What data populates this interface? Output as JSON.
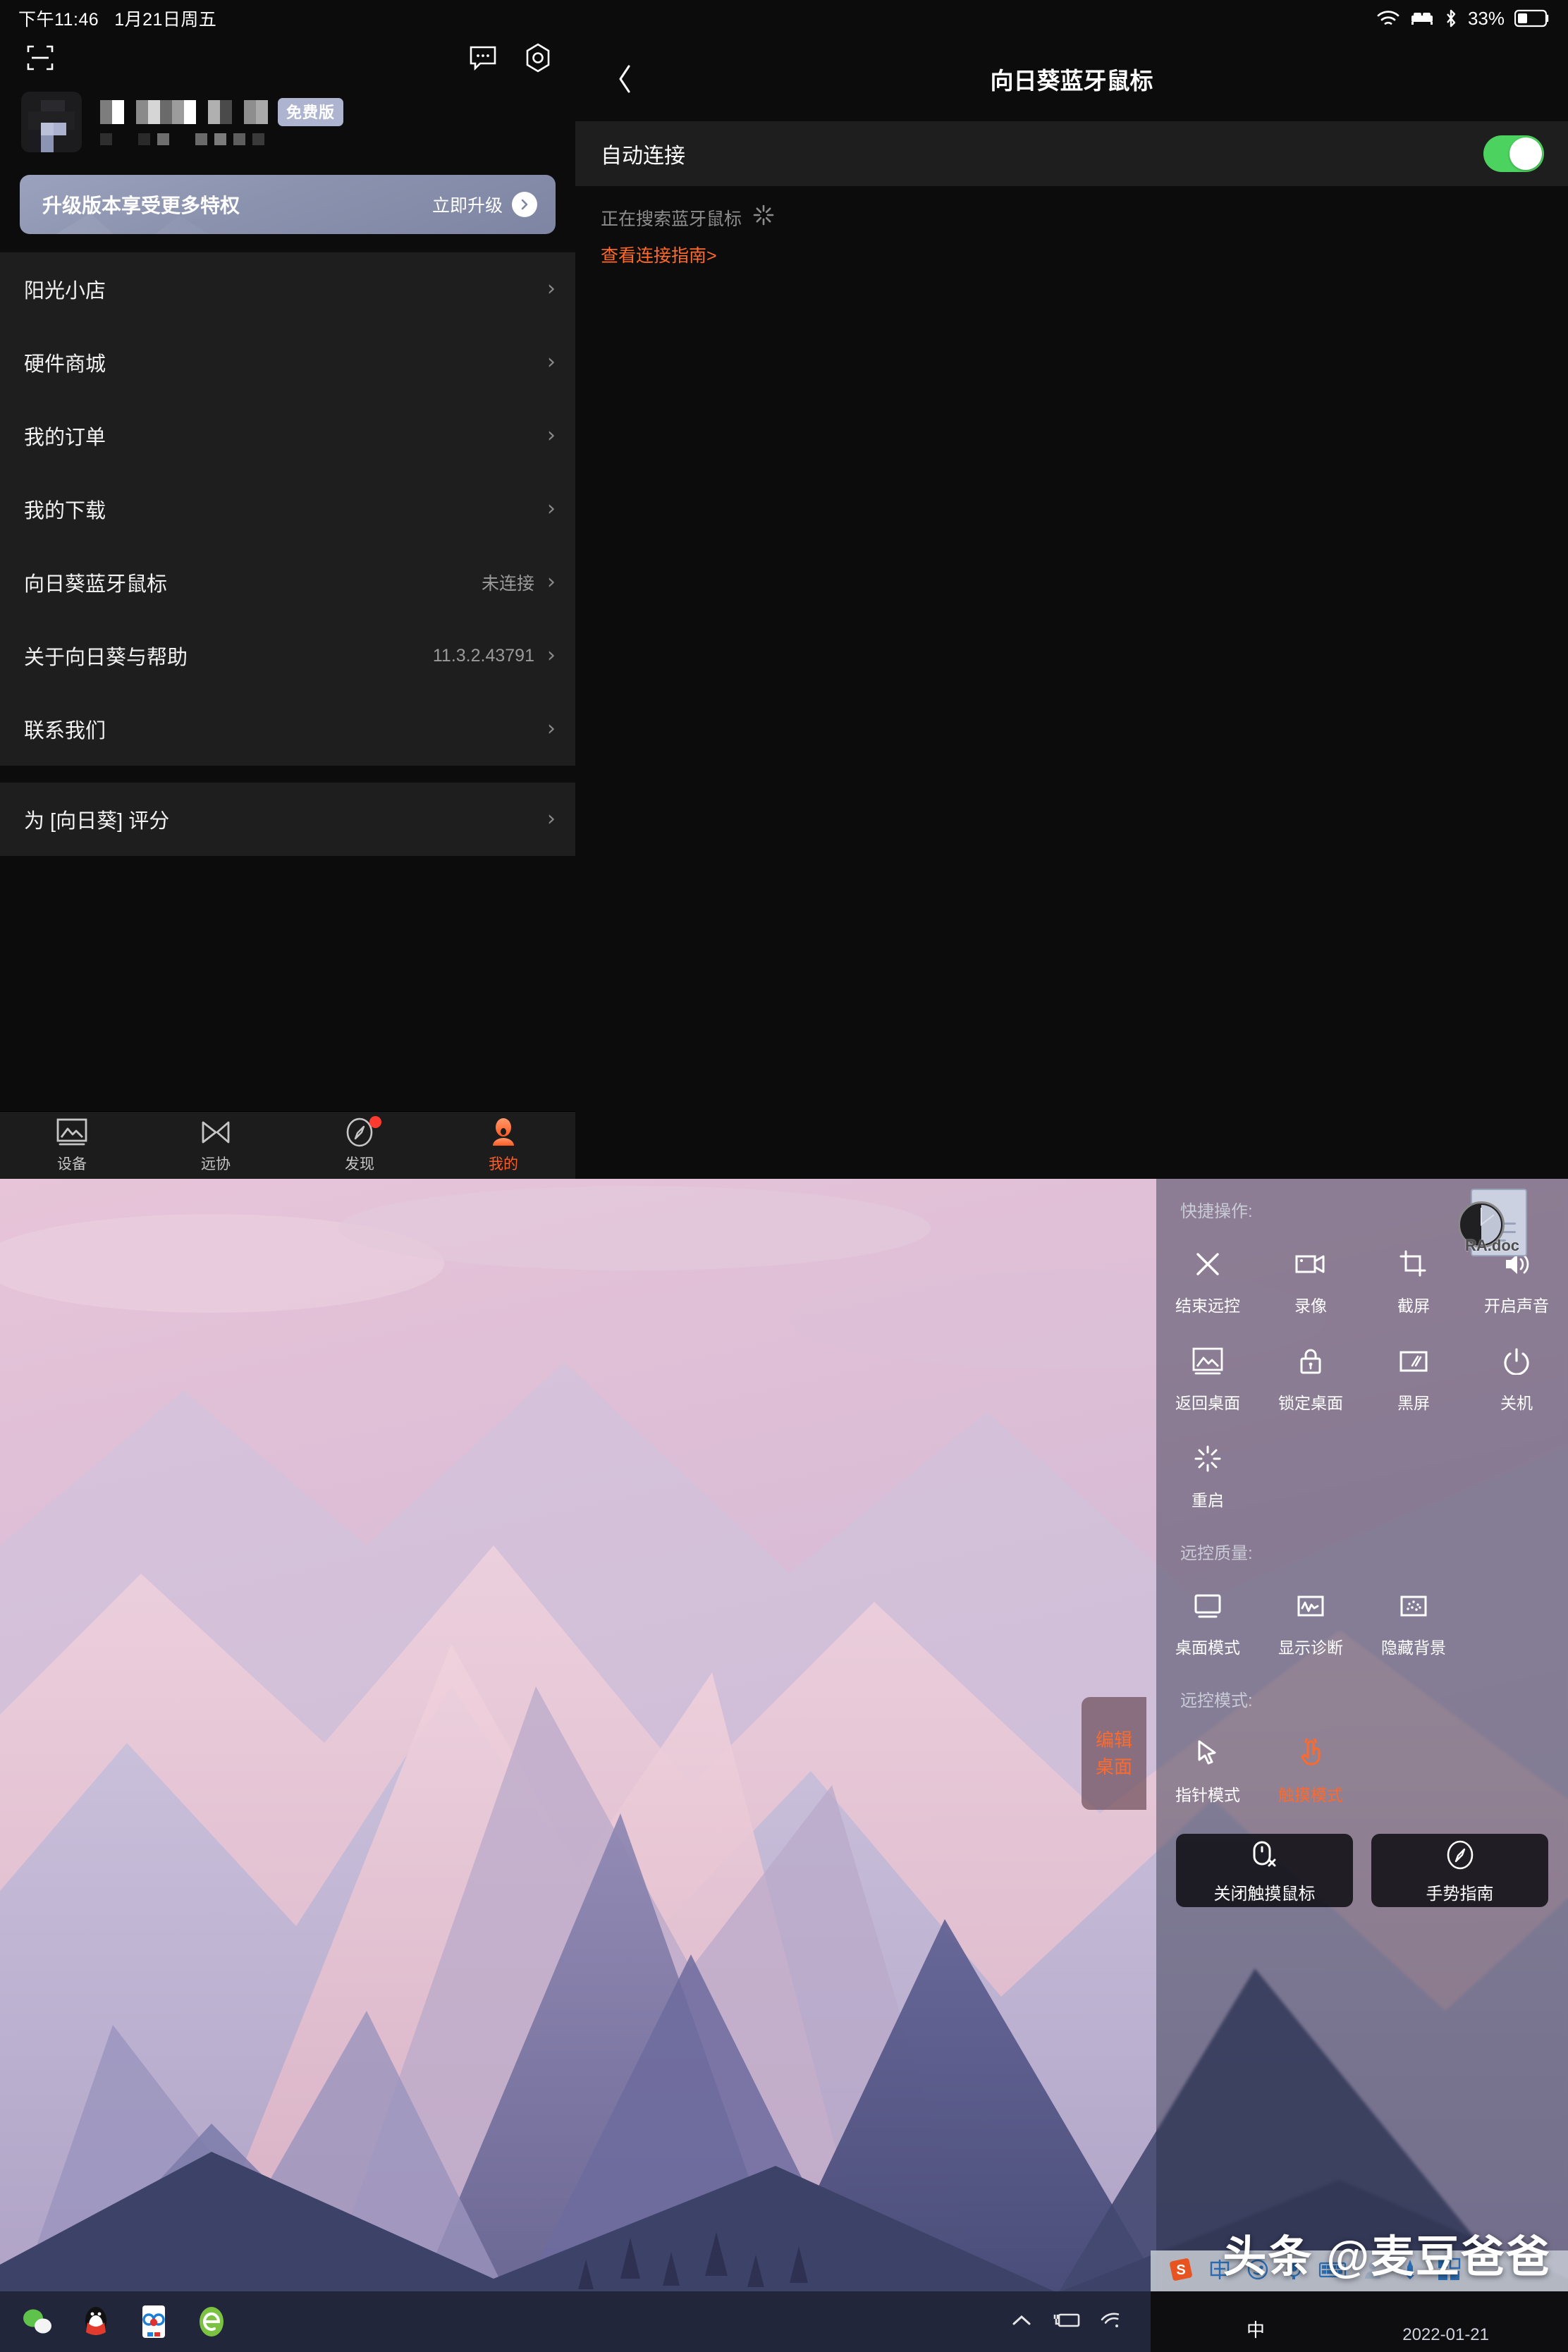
{
  "status_bar": {
    "time": "下午11:46",
    "date": "1月21日周五",
    "battery_percent": "33%",
    "icons": [
      "wifi-icon",
      "bed-icon",
      "bluetooth-icon",
      "battery-icon"
    ]
  },
  "sidebar": {
    "top_icons": [
      "scan-icon",
      "message-icon",
      "settings-hexagon-icon"
    ],
    "profile": {
      "badge": "免费版",
      "username_masked": true
    },
    "upgrade_banner": {
      "title": "升级版本享受更多特权",
      "cta": "立即升级"
    },
    "menu_group_1": [
      {
        "label": "阳光小店",
        "value": ""
      },
      {
        "label": "硬件商城",
        "value": ""
      },
      {
        "label": "我的订单",
        "value": ""
      },
      {
        "label": "我的下载",
        "value": ""
      },
      {
        "label": "向日葵蓝牙鼠标",
        "value": "未连接"
      },
      {
        "label": "关于向日葵与帮助",
        "value": "11.3.2.43791"
      },
      {
        "label": "联系我们",
        "value": ""
      }
    ],
    "menu_group_2": [
      {
        "label": "为 [向日葵] 评分",
        "value": ""
      }
    ],
    "tabs": [
      {
        "label": "设备",
        "icon": "image-mountain-icon",
        "active": false,
        "badge": false
      },
      {
        "label": "远协",
        "icon": "play-pair-icon",
        "active": false,
        "badge": false
      },
      {
        "label": "发现",
        "icon": "compass-icon",
        "active": false,
        "badge": true
      },
      {
        "label": "我的",
        "icon": "person-icon",
        "active": true,
        "badge": false
      }
    ]
  },
  "detail": {
    "title": "向日葵蓝牙鼠标",
    "back_icon": "chevron-left-icon",
    "auto_connect_label": "自动连接",
    "auto_connect_on": true,
    "searching_text": "正在搜索蓝牙鼠标",
    "guide_link": "查看连接指南>"
  },
  "remote_panel": {
    "section_quick": "快捷操作:",
    "quick_items": [
      {
        "label": "结束远控",
        "icon": "close-x-icon",
        "accent": false
      },
      {
        "label": "录像",
        "icon": "video-camera-icon",
        "accent": false
      },
      {
        "label": "截屏",
        "icon": "crop-screenshot-icon",
        "accent": false
      },
      {
        "label": "开启声音",
        "icon": "speaker-icon",
        "accent": false
      },
      {
        "label": "返回桌面",
        "icon": "image-mountain-icon",
        "accent": false
      },
      {
        "label": "锁定桌面",
        "icon": "lock-icon",
        "accent": false
      },
      {
        "label": "黑屏",
        "icon": "black-screen-icon",
        "accent": false
      },
      {
        "label": "关机",
        "icon": "power-icon",
        "accent": false
      },
      {
        "label": "重启",
        "icon": "restart-spinner-icon",
        "accent": false
      }
    ],
    "section_quality": "远控质量:",
    "quality_items": [
      {
        "label": "桌面模式",
        "icon": "monitor-icon"
      },
      {
        "label": "显示诊断",
        "icon": "waveform-icon"
      },
      {
        "label": "隐藏背景",
        "icon": "hide-background-icon"
      }
    ],
    "section_mode": "远控模式:",
    "mode_items": [
      {
        "label": "指针模式",
        "icon": "cursor-arrow-icon",
        "active": false
      },
      {
        "label": "触摸模式",
        "icon": "touch-hand-icon",
        "active": true
      }
    ],
    "buttons": [
      {
        "label": "关闭触摸鼠标",
        "icon": "mouse-off-icon"
      },
      {
        "label": "手势指南",
        "icon": "compass-icon"
      }
    ],
    "edit_desktop": "编辑桌面",
    "accent_color": "#ff6a2a"
  },
  "desktop": {
    "file_icon_label": "RA.doc",
    "taskbar_apps": [
      "wechat-icon",
      "qq-penguin-icon",
      "wps-icon",
      "ebrowser-icon"
    ],
    "tray_icons": [
      "chevron-up-icon",
      "battery-plug-icon",
      "wifi-icon"
    ],
    "tray_right_icons": [
      "sogou-s-icon",
      "ime-chinese-icon",
      "emoji-icon",
      "mic-icon",
      "keyboard-icon",
      "user-icon",
      "tools-icon",
      "grid-icon"
    ],
    "ime_label": "中",
    "date": "2022-01-21"
  },
  "watermark": {
    "text": "头条 @麦豆爸爸"
  }
}
